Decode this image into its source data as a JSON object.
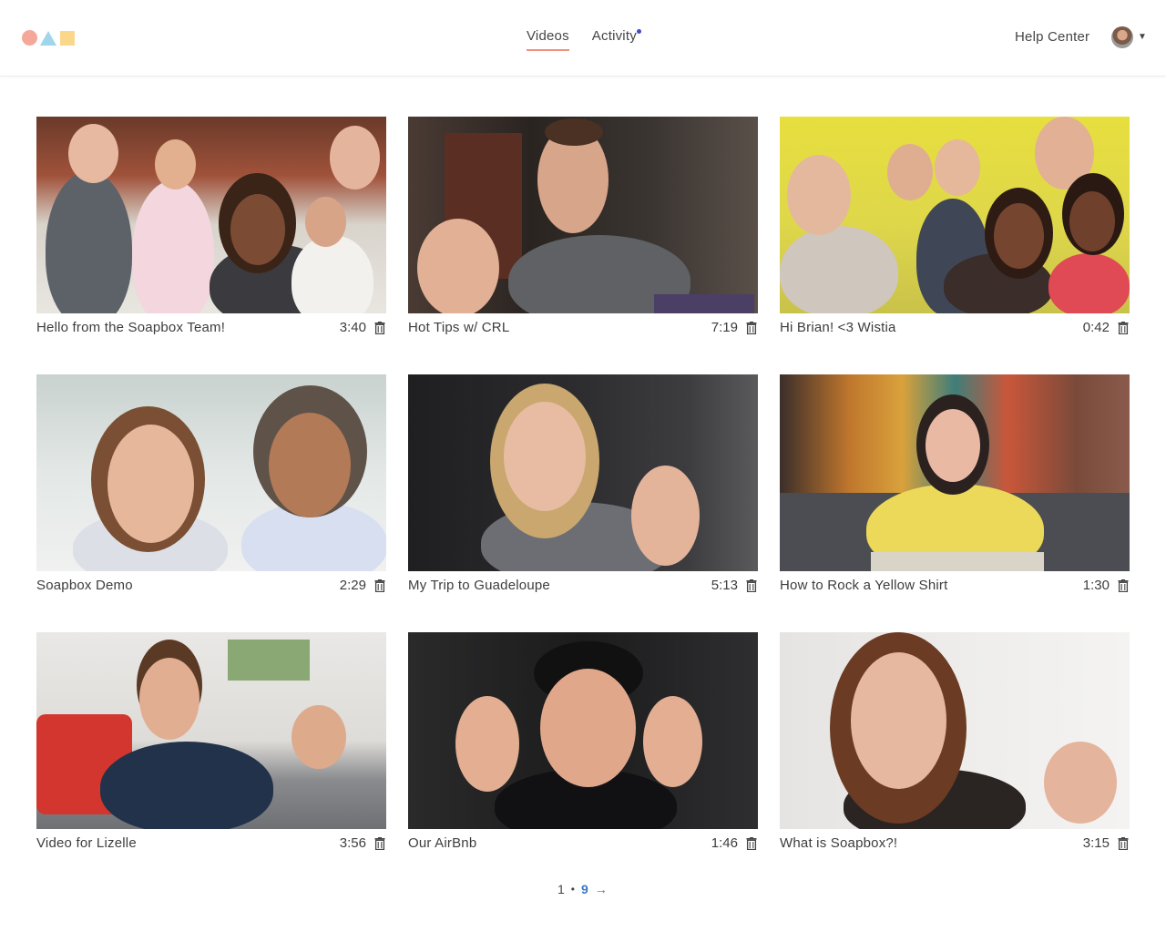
{
  "nav": {
    "videos_label": "Videos",
    "activity_label": "Activity",
    "help_label": "Help Center"
  },
  "colors": {
    "logo_circle": "#f5a89a",
    "logo_triangle": "#9fd6ea",
    "logo_square": "#fbd78c",
    "active_underline": "#ef8f7c",
    "activity_dot": "#3d4cc7",
    "pager_link": "#3a78c9"
  },
  "icons": {
    "logo": "circle-triangle-square-logo",
    "avatar": "user-avatar",
    "account_menu": "caret-down-icon",
    "delete": "trash-icon",
    "next": "arrow-right-icon"
  },
  "videos": [
    {
      "title": "Hello from the Soapbox Team!",
      "duration": "3:40"
    },
    {
      "title": "Hot Tips w/ CRL",
      "duration": "7:19"
    },
    {
      "title": "Hi Brian! <3 Wistia",
      "duration": "0:42"
    },
    {
      "title": "Soapbox Demo",
      "duration": "2:29"
    },
    {
      "title": "My Trip to Guadeloupe",
      "duration": "5:13"
    },
    {
      "title": "How to Rock a Yellow Shirt",
      "duration": "1:30"
    },
    {
      "title": "Video for Lizelle",
      "duration": "3:56"
    },
    {
      "title": "Our AirBnb",
      "duration": "1:46"
    },
    {
      "title": "What is Soapbox?!",
      "duration": "3:15"
    }
  ],
  "pagination": {
    "current": "1",
    "separator": "•",
    "last": "9",
    "next": "→"
  }
}
